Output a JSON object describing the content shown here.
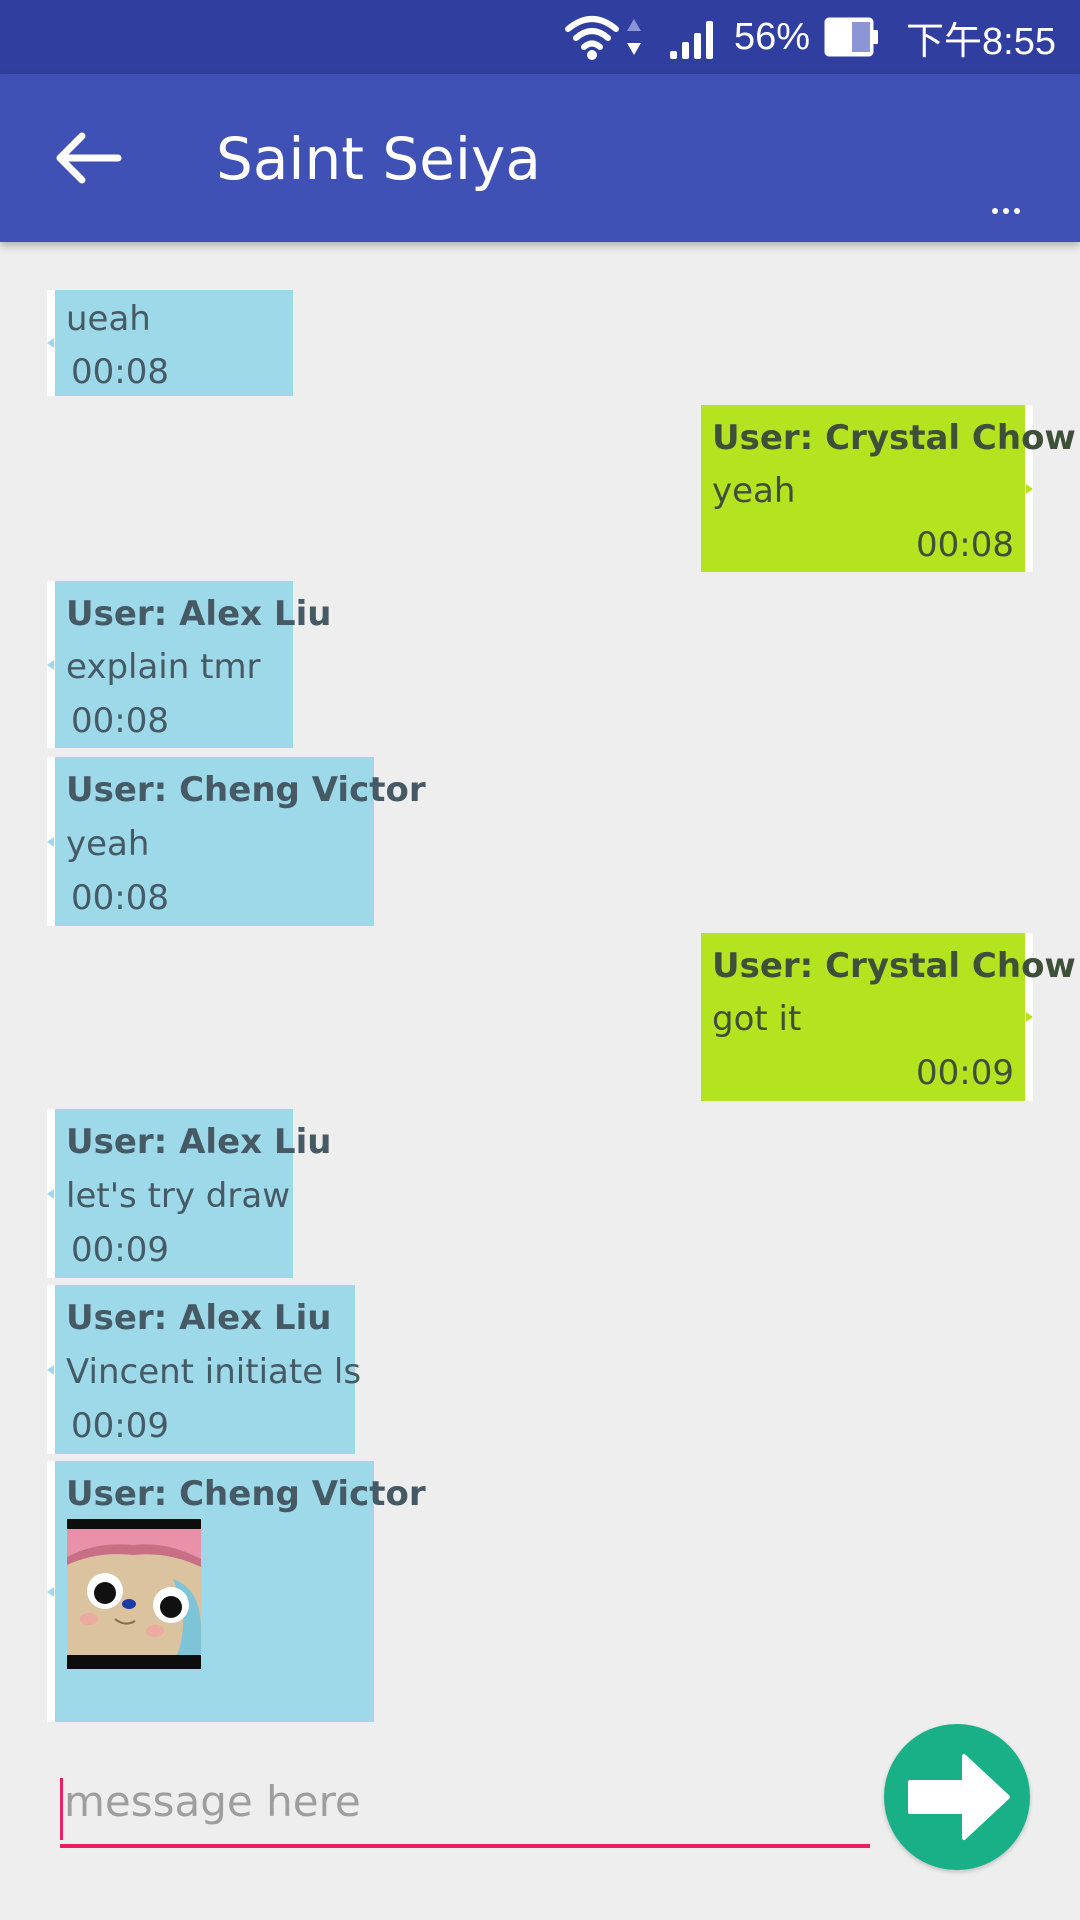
{
  "status_bar": {
    "battery": "56%",
    "time": "下午8:55",
    "icons": [
      "wifi-icon",
      "data-arrows-icon",
      "signal-icon",
      "battery-icon"
    ]
  },
  "app_bar": {
    "title": "Saint Seiya",
    "back_icon": "arrow-left-icon",
    "overflow_label": "..."
  },
  "messages": [
    {
      "direction": "incoming",
      "sender": "",
      "text": "ueah",
      "time": "00:08"
    },
    {
      "direction": "outgoing",
      "sender": "User: Crystal Chow",
      "text": "yeah",
      "time": "00:08"
    },
    {
      "direction": "incoming",
      "sender": "User: Alex Liu",
      "text": "explain tmr",
      "time": "00:08"
    },
    {
      "direction": "incoming",
      "sender": "User: Cheng Victor",
      "text": "yeah",
      "time": "00:08"
    },
    {
      "direction": "outgoing",
      "sender": "User: Crystal Chow",
      "text": "got it",
      "time": "00:09"
    },
    {
      "direction": "incoming",
      "sender": "User: Alex Liu",
      "text": "let's try draw",
      "time": "00:09"
    },
    {
      "direction": "incoming",
      "sender": "User: Alex Liu",
      "text": "Vincent initiate ls",
      "time": "00:09"
    },
    {
      "direction": "incoming",
      "sender": "User: Cheng Victor",
      "image": "chopper-image",
      "time": ""
    }
  ],
  "composer": {
    "placeholder": "message here",
    "value": "",
    "send_icon": "arrow-right-icon"
  },
  "colors": {
    "status_bar": "#303f9f",
    "app_bar": "#3f51b5",
    "incoming_bubble": "#9ed9ea",
    "outgoing_bubble": "#b3e41f",
    "accent": "#e91e63",
    "send_button": "#19b088"
  }
}
